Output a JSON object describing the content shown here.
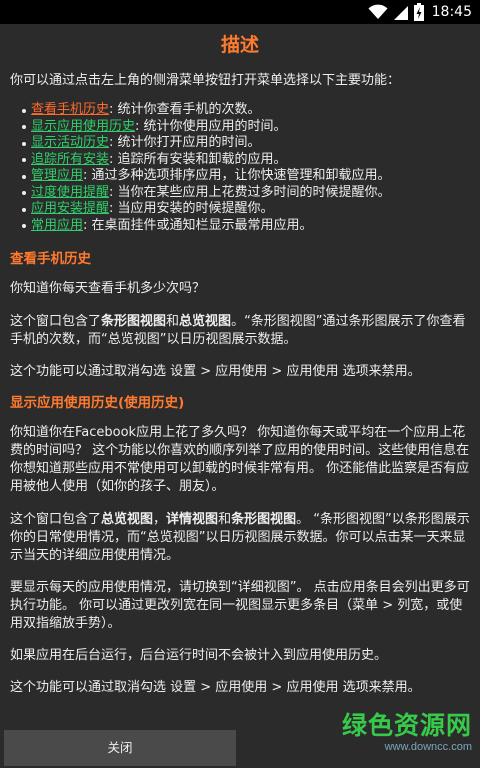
{
  "status": {
    "time": "18:45"
  },
  "dialog": {
    "title": "描述",
    "intro": "你可以通过点击左上角的侧滑菜单按钮打开菜单选择以下主要功能：",
    "features": [
      {
        "link": "查看手机历史",
        "desc": ": 统计你查看手机的次数。"
      },
      {
        "link": "显示应用使用历史",
        "desc": ": 统计你使用应用的时间。"
      },
      {
        "link": "显示活动历史",
        "desc": ": 统计你打开应用的时间。"
      },
      {
        "link": "追踪所有安装",
        "desc": ": 追踪所有安装和卸载的应用。"
      },
      {
        "link": "管理应用",
        "desc": ": 通过多种选项排序应用，让你快速管理和卸载应用。"
      },
      {
        "link": "过度使用提醒",
        "desc": ": 当你在某些应用上花费过多时间的时候提醒你。"
      },
      {
        "link": "应用安装提醒",
        "desc": ": 当应用安装的时候提醒你。"
      },
      {
        "link": "常用应用",
        "desc": ": 在桌面挂件或通知栏显示最常用应用。"
      }
    ],
    "section1": {
      "heading": "查看手机历史",
      "p1": "你知道你每天查看手机多少次吗？",
      "p2_a": "这个窗口包含了",
      "p2_b1": "条形图视图",
      "p2_c": "和",
      "p2_b2": "总览视图",
      "p2_d": "。“条形图视图”通过条形图展示了你查看手机的次数，而“总览视图”以日历视图展示数据。",
      "p3": "这个功能可以通过取消勾选 设置 > 应用使用 > 应用使用 选项来禁用。"
    },
    "section2": {
      "heading": "显示应用使用历史(使用历史)",
      "p1": "你知道你在Facebook应用上花了多久吗？ 你知道你每天或平均在一个应用上花费的时间吗？ 这个功能以你喜欢的顺序列举了应用的使用时间。这些使用信息在你想知道那些应用不常使用可以卸载的时候非常有用。 你还能借此监察是否有应用被他人使用（如你的孩子、朋友）。",
      "p2_a": "这个窗口包含了",
      "p2_b1": "总览视图",
      "p2_c": "，",
      "p2_b2": "详情视图",
      "p2_d": "和",
      "p2_b3": "条形图视图",
      "p2_e": "。 “条形图视图”以条形图展示你的日常使用情况，而“总览视图”以日历视图展示数据。你可以点击某一天来显示当天的详细应用使用情况。",
      "p3": "要显示每天的应用使用情况，请切换到“详细视图”。 点击应用条目会列出更多可执行功能。 你可以通过更改列宽在同一视图显示更多条目（菜单 > 列宽，或使用双指缩放手势）。",
      "p4": "如果应用在后台运行，后台运行时间不会被计入到应用使用历史。",
      "p5": "这个功能可以通过取消勾选 设置 > 应用使用 > 应用使用 选项来禁用。"
    },
    "close_label": "关闭"
  },
  "watermark": {
    "main": "绿色资源网",
    "sub": "www.downcc.com"
  },
  "colors": {
    "accent": "#ff7a2e",
    "link": "#2fd06a",
    "visited_link": "#ff6a2e",
    "background": "#2b2b2b"
  }
}
